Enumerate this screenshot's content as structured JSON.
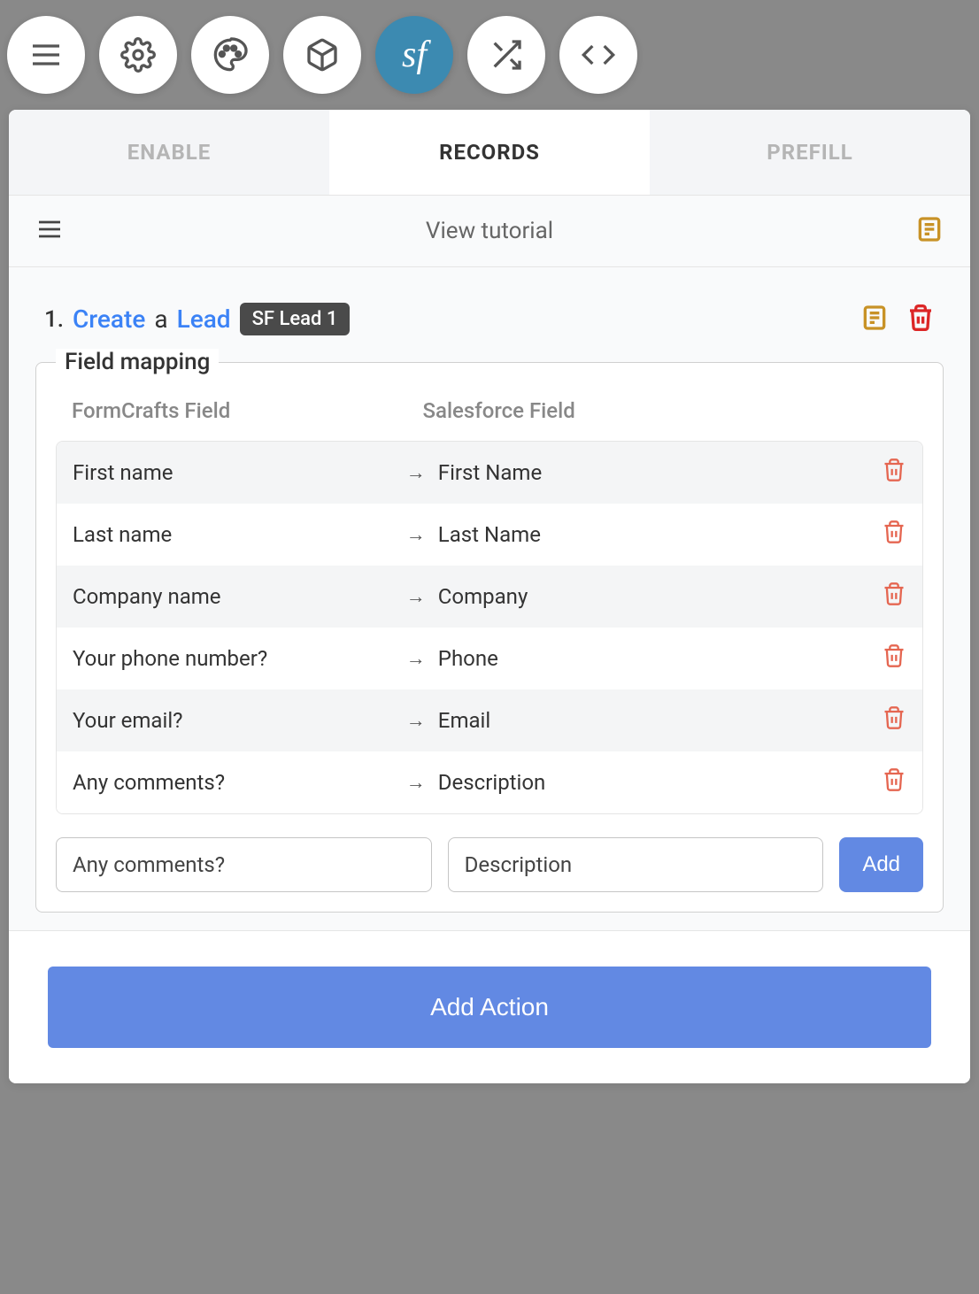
{
  "tabs": {
    "enable": "ENABLE",
    "records": "RECORDS",
    "prefill": "PREFILL"
  },
  "subheader": {
    "title": "View tutorial"
  },
  "action": {
    "number": "1.",
    "verb": "Create",
    "conjunction": "a",
    "object": "Lead",
    "badge": "SF Lead 1"
  },
  "fieldMapping": {
    "legend": "Field mapping",
    "leftHeader": "FormCrafts Field",
    "rightHeader": "Salesforce Field",
    "rows": [
      {
        "from": "First name",
        "to": "First Name"
      },
      {
        "from": "Last name",
        "to": "Last Name"
      },
      {
        "from": "Company name",
        "to": "Company"
      },
      {
        "from": "Your phone number?",
        "to": "Phone"
      },
      {
        "from": "Your email?",
        "to": "Email"
      },
      {
        "from": "Any comments?",
        "to": "Description"
      }
    ],
    "newFrom": "Any comments?",
    "newTo": "Description",
    "addLabel": "Add"
  },
  "footer": {
    "addAction": "Add Action"
  }
}
